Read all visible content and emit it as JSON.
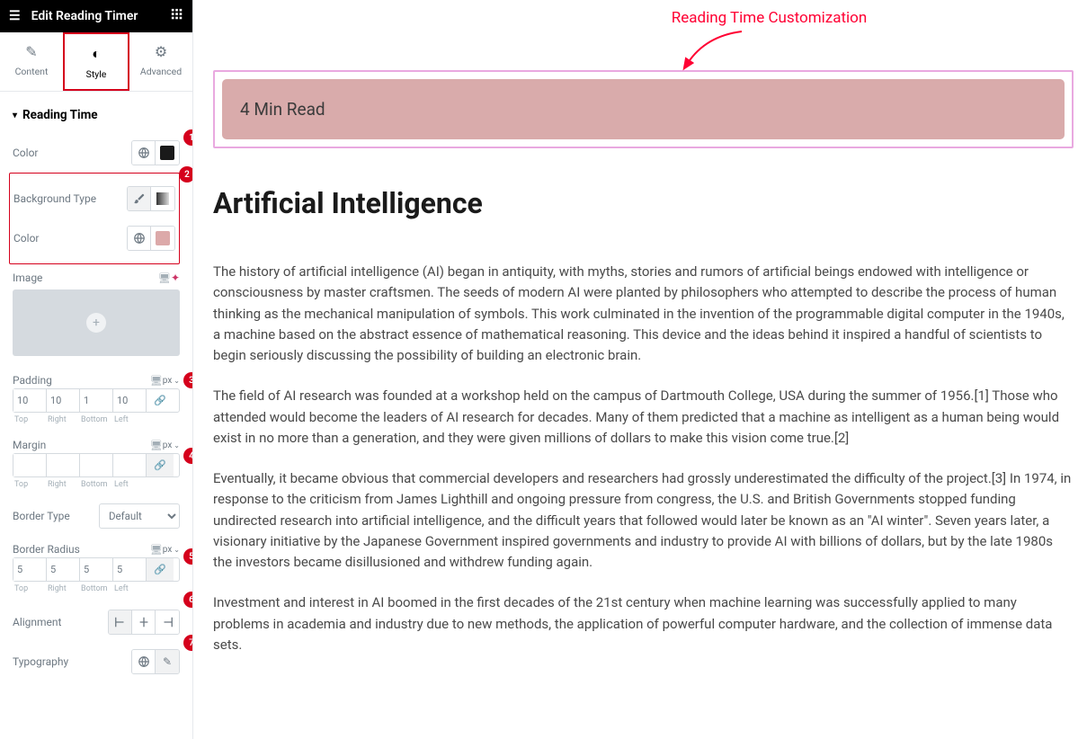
{
  "header": {
    "title": "Edit Reading Timer"
  },
  "tabs": {
    "content": "Content",
    "style": "Style",
    "advanced": "Advanced"
  },
  "section": {
    "title": "Reading Time"
  },
  "controls": {
    "color_label": "Color",
    "bg_type_label": "Background Type",
    "bg_color_label": "Color",
    "image_label": "Image",
    "padding_label": "Padding",
    "padding": {
      "top": "10",
      "right": "10",
      "bottom": "1",
      "left": "10"
    },
    "margin_label": "Margin",
    "margin": {
      "top": "",
      "right": "",
      "bottom": "",
      "left": ""
    },
    "border_type_label": "Border Type",
    "border_type_value": "Default",
    "border_radius_label": "Border Radius",
    "border_radius": {
      "top": "5",
      "right": "5",
      "bottom": "5",
      "left": "5"
    },
    "alignment_label": "Alignment",
    "typography_label": "Typography",
    "unit_px": "px",
    "dim_labels": {
      "top": "Top",
      "right": "Right",
      "bottom": "Bottom",
      "left": "Left"
    }
  },
  "badges": {
    "b1": "1",
    "b2": "2",
    "b3": "3",
    "b4": "4",
    "b5": "5",
    "b6": "6",
    "b7": "7"
  },
  "annotation": {
    "title": "Reading Time Customization"
  },
  "preview": {
    "reading_time": "4 Min Read",
    "article_title": "Artificial Intelligence",
    "paragraphs": [
      "The history of artificial intelligence (AI) began in antiquity, with myths, stories and rumors of artificial beings endowed with intelligence or consciousness by master craftsmen. The seeds of modern AI were planted by philosophers who attempted to describe the process of human thinking as the mechanical manipulation of symbols. This work culminated in the invention of the programmable digital computer in the 1940s, a machine based on the abstract essence of mathematical reasoning. This device and the ideas behind it inspired a handful of scientists to begin seriously discussing the possibility of building an electronic brain.",
      "The field of AI research was founded at a workshop held on the campus of Dartmouth College, USA during the summer of 1956.[1] Those who attended would become the leaders of AI research for decades. Many of them predicted that a machine as intelligent as a human being would exist in no more than a generation, and they were given millions of dollars to make this vision come true.[2]",
      "Eventually, it became obvious that commercial developers and researchers had grossly underestimated the difficulty of the project.[3] In 1974, in response to the criticism from James Lighthill and ongoing pressure from congress, the U.S. and British Governments stopped funding undirected research into artificial intelligence, and the difficult years that followed would later be known as an \"AI winter\". Seven years later, a visionary initiative by the Japanese Government inspired governments and industry to provide AI with billions of dollars, but by the late 1980s the investors became disillusioned and withdrew funding again.",
      "Investment and interest in AI boomed in the first decades of the 21st century when machine learning was successfully applied to many problems in academia and industry due to new methods, the application of powerful computer hardware, and the collection of immense data sets."
    ]
  }
}
